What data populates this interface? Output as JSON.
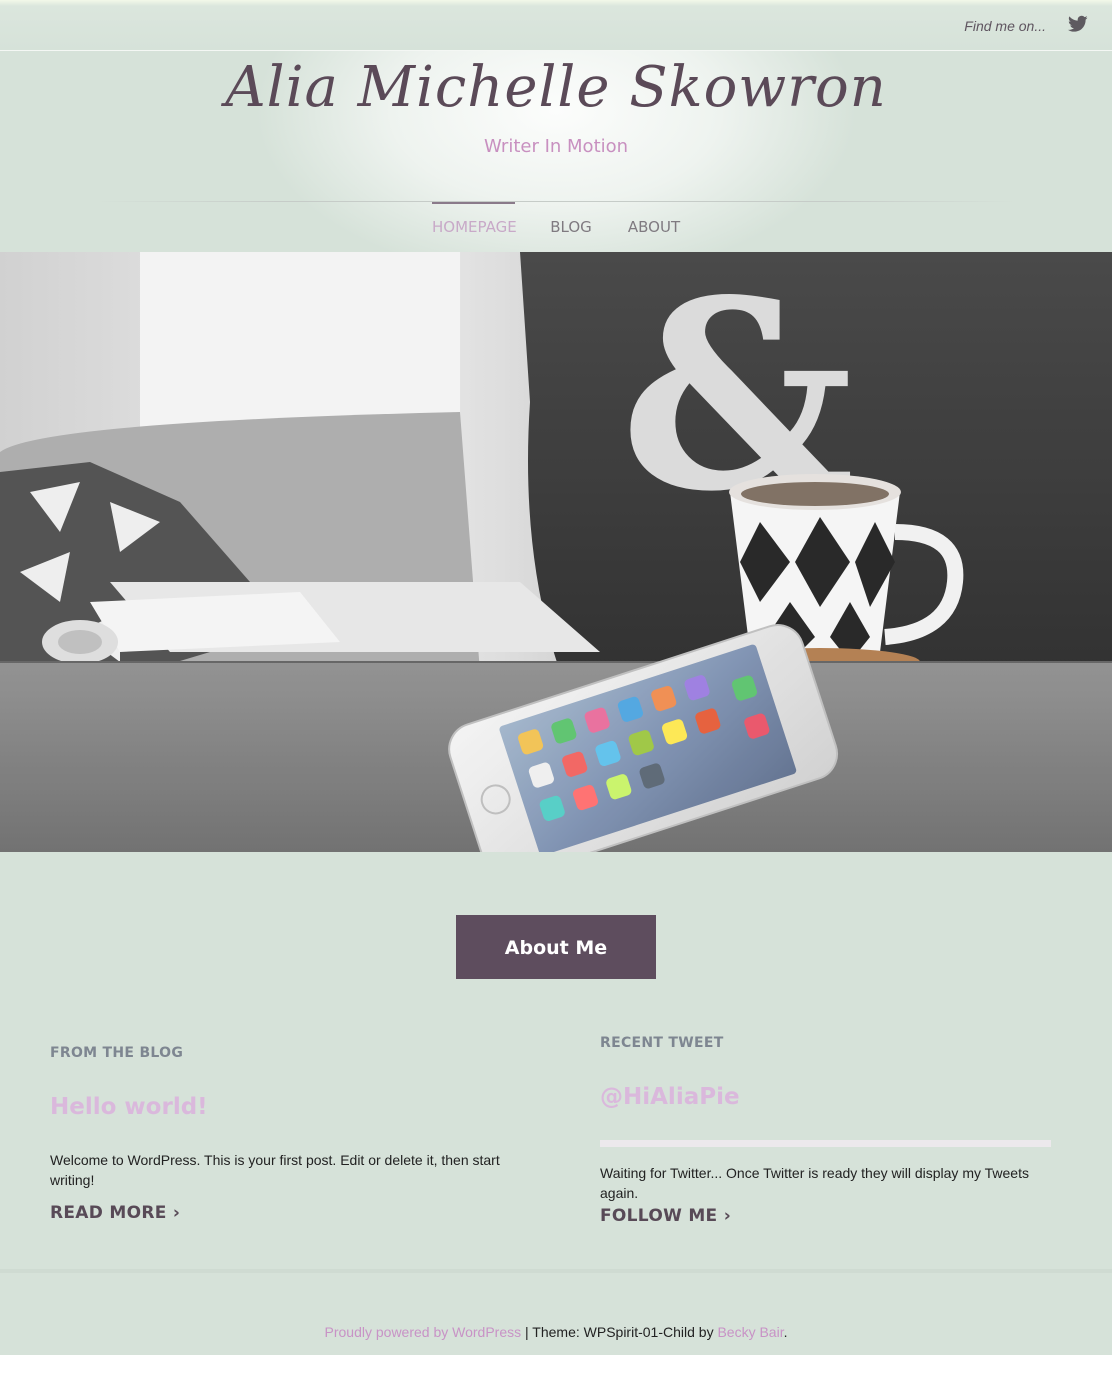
{
  "topbar": {
    "find_me": "Find me on...",
    "social_icon": "twitter-icon"
  },
  "header": {
    "title": "Alia Michelle Skowron",
    "tagline": "Writer In Motion"
  },
  "nav": {
    "items": [
      {
        "label": "HOMEPAGE",
        "active": true
      },
      {
        "label": "BLOG",
        "active": false
      },
      {
        "label": "ABOUT",
        "active": false
      }
    ]
  },
  "hero": {
    "subject": "coffee-mug-phone-magazine-photo"
  },
  "cta": {
    "about_label": "About Me"
  },
  "blog": {
    "section_label": "FROM THE BLOG",
    "post_title": "Hello world!",
    "excerpt": "Welcome to WordPress. This is your first post. Edit or delete it, then start writing!",
    "read_more": "READ MORE ›"
  },
  "tweet": {
    "section_label": "RECENT TWEET",
    "handle": "@HiAliaPie",
    "text": "Waiting for Twitter... Once Twitter is ready they will display my Tweets again.",
    "follow": "FOLLOW ME ›"
  },
  "footer": {
    "powered": "Proudly powered by WordPress",
    "sep": " | Theme: WPSpirit-01-Child by ",
    "author": "Becky Bair",
    "end": "."
  },
  "colors": {
    "background": "#d6e2d9",
    "accent": "#5e4d5e",
    "link_pink": "#c893c6"
  }
}
